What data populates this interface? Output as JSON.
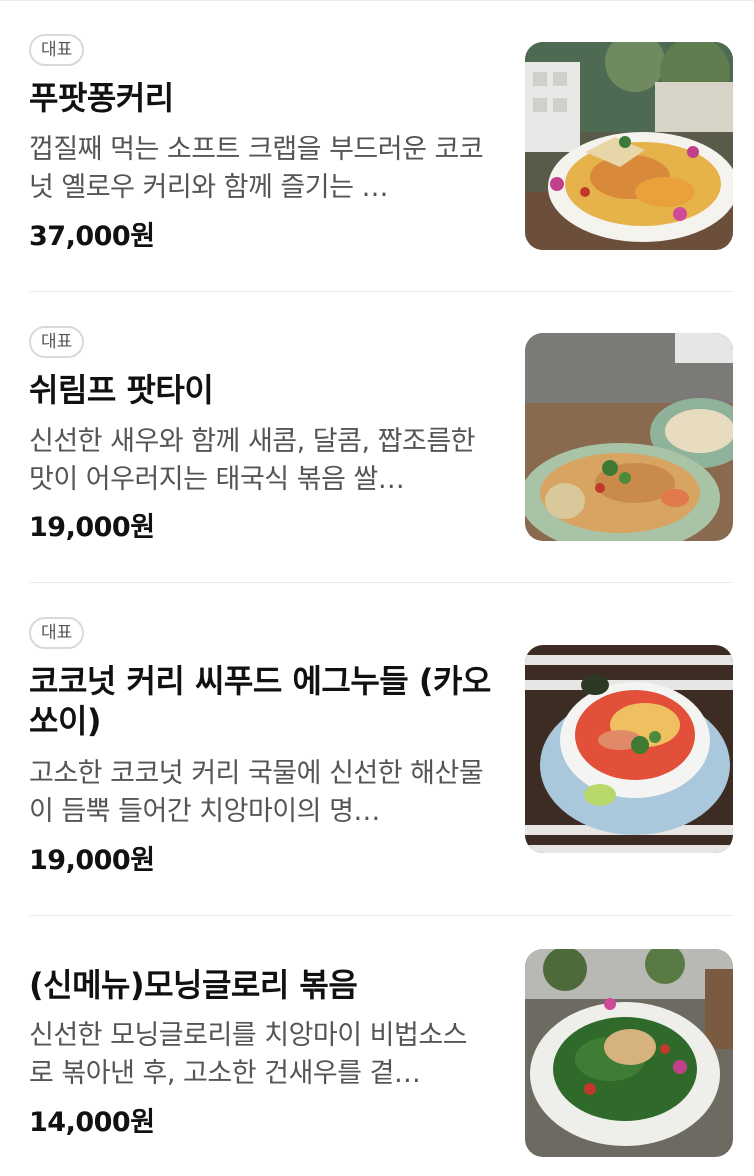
{
  "menu": {
    "items": [
      {
        "badge": "대표",
        "name": "푸팟퐁커리",
        "description": "껍질째 먹는 소프트 크랩을 부드러운 코코넛 옐로우 커리와 함께 즐기는 …",
        "price": "37,000원",
        "image": "yellow-curry-crab-photo"
      },
      {
        "badge": "대표",
        "name": "쉬림프 팟타이",
        "description": "신선한 새우와 함께 새콤, 달콤, 짭조름한 맛이 어우러지는 태국식 볶음 쌀…",
        "price": "19,000원",
        "image": "shrimp-pad-thai-photo"
      },
      {
        "badge": "대표",
        "name": "코코넛 커리 씨푸드 에그누들 (카오쏘이)",
        "description": "고소한 코코넛 커리 국물에 신선한 해산물이 듬뿍 들어간 치앙마이의 명…",
        "price": "19,000원",
        "image": "khao-soi-seafood-noodle-photo"
      },
      {
        "badge": "",
        "name": "(신메뉴)모닝글로리 볶음",
        "description": "신선한 모닝글로리를 치앙마이 비법소스로 볶아낸 후, 고소한 건새우를 곁…",
        "price": "14,000원",
        "image": "morning-glory-stir-fry-photo"
      }
    ]
  }
}
